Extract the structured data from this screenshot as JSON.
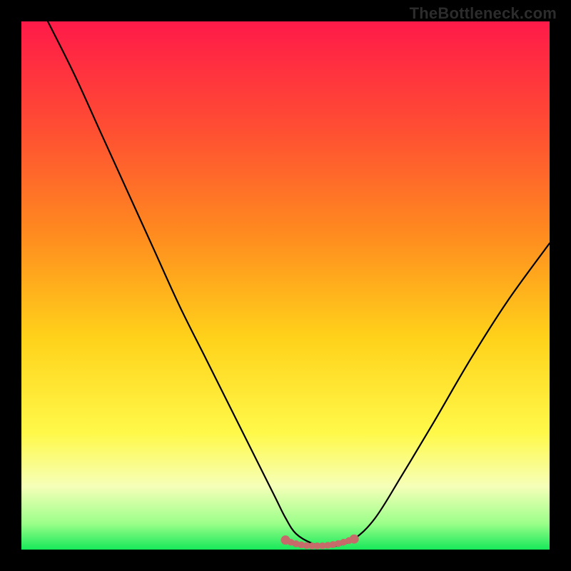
{
  "watermark": "TheBottleneck.com",
  "chart_data": {
    "type": "line",
    "title": "",
    "xlabel": "",
    "ylabel": "",
    "xlim": [
      0,
      100
    ],
    "ylim": [
      0,
      100
    ],
    "grid": false,
    "legend": false,
    "gradient_stops": [
      {
        "pos": 0.0,
        "color": "#ff1a49"
      },
      {
        "pos": 0.2,
        "color": "#ff4d33"
      },
      {
        "pos": 0.4,
        "color": "#ff8a1f"
      },
      {
        "pos": 0.6,
        "color": "#ffd21a"
      },
      {
        "pos": 0.78,
        "color": "#fff94a"
      },
      {
        "pos": 0.88,
        "color": "#f6ffb8"
      },
      {
        "pos": 0.95,
        "color": "#9cff8a"
      },
      {
        "pos": 1.0,
        "color": "#17e85a"
      }
    ],
    "series": [
      {
        "name": "bottleneck-curve",
        "color": "#000000",
        "width": 2.2,
        "x": [
          5,
          10,
          15,
          20,
          25,
          30,
          35,
          40,
          45,
          48,
          50,
          52,
          55,
          58,
          60,
          63,
          67,
          72,
          78,
          85,
          92,
          100
        ],
        "y": [
          100,
          90,
          79,
          68,
          57,
          46,
          36,
          26,
          16,
          10,
          6,
          3,
          1.2,
          0.6,
          0.8,
          2,
          6,
          14,
          24,
          36,
          47,
          58
        ]
      }
    ],
    "highlight": {
      "name": "optimal-range",
      "color": "#c76a6a",
      "stroke": "#c76a6a",
      "x": [
        50,
        51,
        52,
        53,
        54,
        55,
        56,
        57,
        58,
        59,
        60,
        61,
        62,
        63
      ],
      "y": [
        1.8,
        1.4,
        1.1,
        0.9,
        0.75,
        0.7,
        0.7,
        0.72,
        0.8,
        0.95,
        1.15,
        1.4,
        1.7,
        2.0
      ]
    }
  }
}
